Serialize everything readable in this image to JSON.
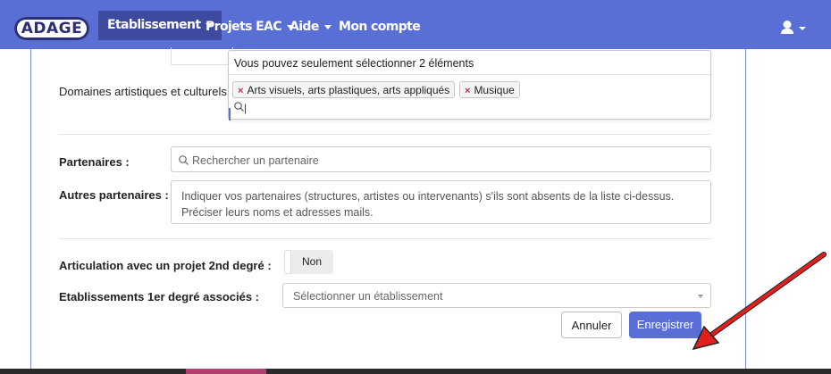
{
  "navbar": {
    "logo_text": "ADAGE",
    "items": [
      {
        "label": "Etablissement"
      },
      {
        "label": "Projets EAC"
      },
      {
        "label": "Aide"
      },
      {
        "label": "Mon compte"
      }
    ],
    "background_color": "#5a6fd6",
    "active_color": "#3d4aa0"
  },
  "form": {
    "domaines": {
      "label": "Domaines artistiques et culturels",
      "limit_message": "Vous pouvez seulement sélectionner 2 éléments",
      "selected": [
        {
          "label": "Arts visuels, arts plastiques, arts appliqués"
        },
        {
          "label": "Musique"
        }
      ],
      "search_icon": "search-icon"
    },
    "partenaires": {
      "label": "Partenaires :",
      "placeholder": "Rechercher un partenaire"
    },
    "autres_partenaires": {
      "label": "Autres partenaires :",
      "placeholder": "Indiquer vos partenaires (structures, artistes ou intervenants) s'ils sont absents de la liste ci-dessus. Préciser leurs noms et adresses mails."
    },
    "articulation": {
      "label": "Articulation avec un projet 2nd degré :",
      "value": "Non"
    },
    "etablissements": {
      "label": "Etablissements 1er degré associés :",
      "placeholder": "Sélectionner un établissement"
    }
  },
  "actions": {
    "cancel_label": "Annuler",
    "save_label": "Enregistrer",
    "save_color": "#5a6fd6"
  },
  "annotation": {
    "type": "red-arrow",
    "color": "#e0201c"
  }
}
